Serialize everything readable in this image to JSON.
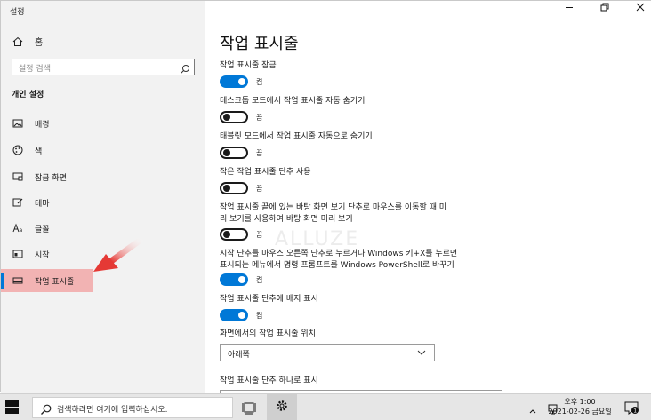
{
  "app": {
    "title": "설정"
  },
  "sidebar": {
    "home_label": "홈",
    "search_placeholder": "설정 검색",
    "section_title": "개인 설정",
    "items": [
      {
        "label": "배경",
        "icon": "picture-icon"
      },
      {
        "label": "색",
        "icon": "palette-icon"
      },
      {
        "label": "잠금 화면",
        "icon": "lock-screen-icon"
      },
      {
        "label": "테마",
        "icon": "brush-icon"
      },
      {
        "label": "글꼴",
        "icon": "font-icon"
      },
      {
        "label": "시작",
        "icon": "start-icon"
      },
      {
        "label": "작업 표시줄",
        "icon": "taskbar-icon",
        "active": true
      }
    ]
  },
  "main": {
    "title": "작업 표시줄",
    "settings": [
      {
        "label": "작업 표시줄 잠금",
        "state": "켬",
        "on": true
      },
      {
        "label": "데스크톱 모드에서 작업 표시줄 자동 숨기기",
        "state": "끔",
        "on": false
      },
      {
        "label": "태블릿 모드에서 작업 표시줄 자동으로 숨기기",
        "state": "끔",
        "on": false
      },
      {
        "label": "작은 작업 표시줄 단추 사용",
        "state": "끔",
        "on": false
      },
      {
        "label_line1": "작업 표시줄 끝에 있는 바탕 화면 보기 단추로 마우스를 이동할 때 미",
        "label_line2": "리 보기를 사용하여 바탕 화면 미리 보기",
        "state": "끔",
        "on": false
      },
      {
        "label_line1": "시작 단추를 마우스 오른쪽 단추로 누르거나 Windows 키+X를 누르면",
        "label_line2": "표시되는 메뉴에서 명령 프롬프트를 Windows PowerShell로 바꾸기",
        "state": "켬",
        "on": true
      },
      {
        "label": "작업 표시줄 단추에 배지 표시",
        "state": "켬",
        "on": true
      }
    ],
    "location_label": "화면에서의 작업 표시줄 위치",
    "location_value": "아래쪽",
    "combine_label": "작업 표시줄 단추 하나로 표시"
  },
  "watermark": "ALLUZE",
  "taskbar": {
    "search_placeholder": "검색하려면 여기에 입력하십시오.",
    "time": "오후 1:00",
    "date": "2021-02-26 금요일",
    "notification_count": "1"
  },
  "colors": {
    "accent": "#0078d7",
    "highlight": "#f2b3b3",
    "arrow": "#e53935"
  }
}
